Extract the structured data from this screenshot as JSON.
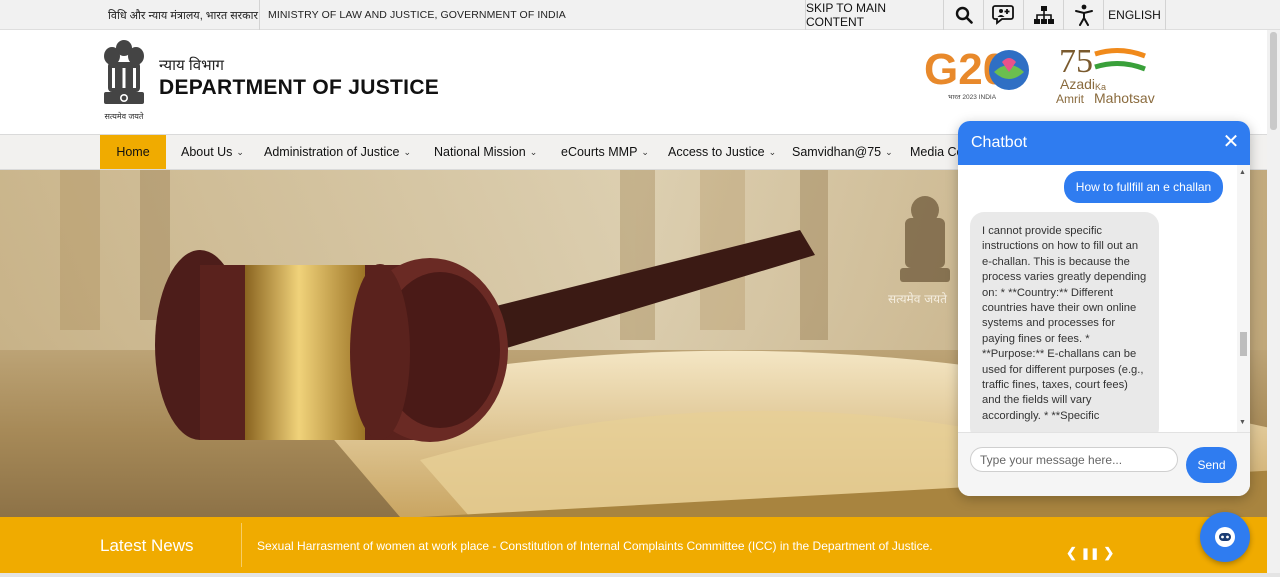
{
  "topbar": {
    "hindi_ministry": "विधि और न्याय मंत्रालय, भारत सरकार",
    "ministry": "MINISTRY OF LAW AND JUSTICE, GOVERNMENT OF INDIA",
    "skip_link": "SKIP TO MAIN CONTENT",
    "language": "ENGLISH",
    "icons": [
      "search-icon",
      "sign-language-icon",
      "sitemap-icon",
      "accessibility-icon"
    ]
  },
  "header": {
    "emblem_caption": "सत्यमेव जयते",
    "dept_hindi": "न्याय विभाग",
    "dept_title": "DEPARTMENT OF JUSTICE",
    "g20_logo_text": "G20",
    "g20_caption": "भारत 2023 INDIA",
    "azadi_azadi": "Azadi",
    "azadi_ka": "Ka",
    "azadi_amrit": "Amrit",
    "azadi_mahotsav": "Mahotsav"
  },
  "nav": {
    "items": [
      {
        "label": "Home",
        "active": true
      },
      {
        "label": "About Us"
      },
      {
        "label": "Administration of Justice"
      },
      {
        "label": "National Mission"
      },
      {
        "label": "eCourts MMP"
      },
      {
        "label": "Access to Justice"
      },
      {
        "label": "Samvidhan@75"
      },
      {
        "label": "Media Co"
      }
    ]
  },
  "hero": {
    "emblem_caption": "सत्यमेव जयते"
  },
  "news": {
    "label": "Latest News",
    "ticker": "Sexual Harrasment of women at work place - Constitution of Internal Complaints Committee (ICC) in the Department of Justice."
  },
  "chatbot": {
    "title": "Chatbot",
    "user_message": "How to fullfill an e challan",
    "bot_message": "I cannot provide specific instructions on how to fill out an e-challan. This is because the process varies greatly depending on: * **Country:** Different countries have their own online systems and processes for paying fines or fees. * **Purpose:** E-challans can be used for different purposes (e.g., traffic fines, taxes, court fees) and the fields will vary accordingly. * **Specific",
    "input_placeholder": "Type your message here...",
    "send_label": "Send"
  },
  "colors": {
    "accent": "#f0ab00",
    "chat_blue": "#2f7cf0"
  }
}
